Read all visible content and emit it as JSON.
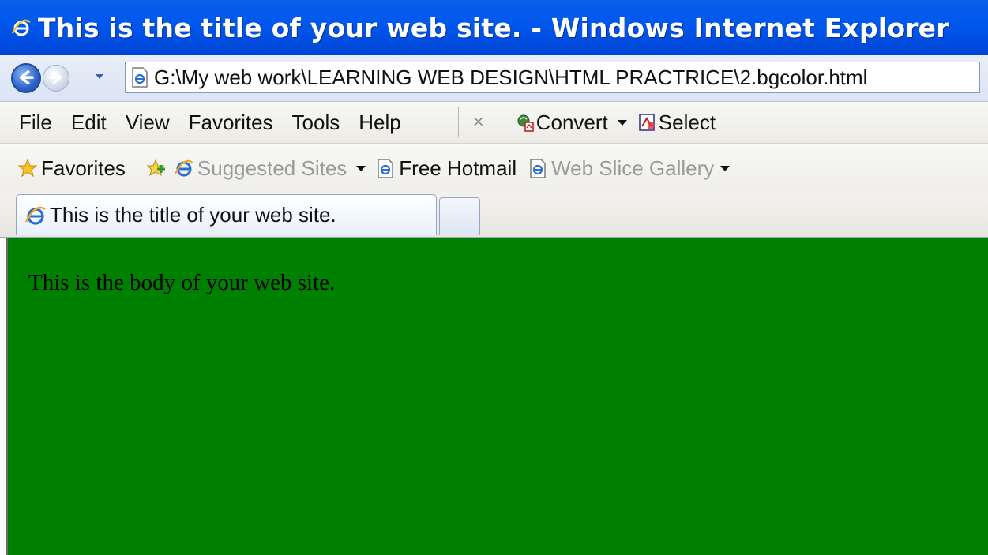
{
  "window": {
    "title": "This is the title of your web site. - Windows Internet Explorer"
  },
  "address_bar": {
    "url": "G:\\My web work\\LEARNING  WEB DESIGN\\HTML PRACTRICE\\2.bgcolor.html"
  },
  "menu": {
    "items": [
      "File",
      "Edit",
      "View",
      "Favorites",
      "Tools",
      "Help"
    ],
    "close_glyph": "×",
    "convert_label": "Convert",
    "select_label": "Select"
  },
  "favorites_bar": {
    "favorites_label": "Favorites",
    "items": [
      {
        "label": "Suggested Sites",
        "dim": true
      },
      {
        "label": "Free Hotmail",
        "dim": false
      },
      {
        "label": "Web Slice Gallery",
        "dim": true
      }
    ]
  },
  "tabs": {
    "active_label": "This is the title of your web site."
  },
  "page": {
    "body_text": "This is the body of your web site.",
    "bgcolor": "#008000"
  },
  "colors": {
    "titlebar": "#0058ee",
    "content_bg": "#008000"
  },
  "icons": [
    "ie-icon",
    "back-arrow-icon",
    "forward-arrow-icon",
    "dropdown-icon",
    "page-icon",
    "star-icon",
    "add-favorite-icon",
    "convert-icon",
    "select-icon",
    "close-icon"
  ]
}
